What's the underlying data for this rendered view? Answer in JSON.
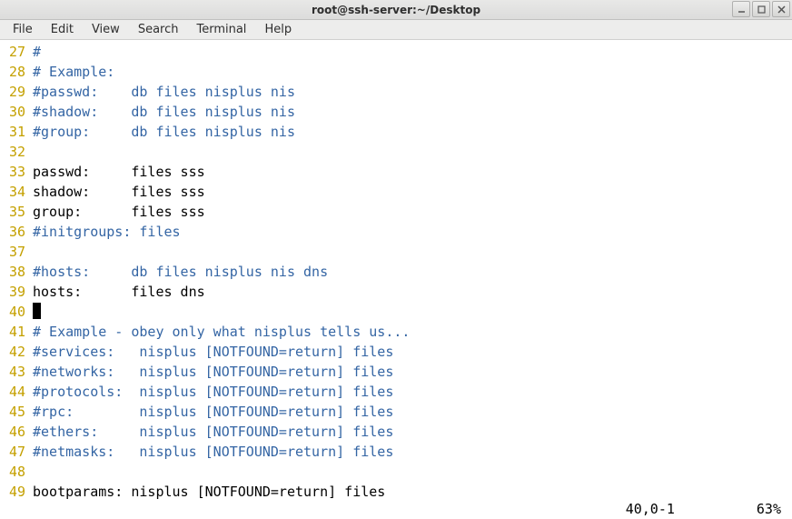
{
  "window": {
    "title": "root@ssh-server:~/Desktop"
  },
  "menu": {
    "file": "File",
    "edit": "Edit",
    "view": "View",
    "search": "Search",
    "terminal": "Terminal",
    "help": "Help"
  },
  "lines": [
    {
      "num": "27",
      "type": "comment",
      "text": "#"
    },
    {
      "num": "28",
      "type": "comment",
      "text": "# Example:"
    },
    {
      "num": "29",
      "type": "comment",
      "text": "#passwd:    db files nisplus nis"
    },
    {
      "num": "30",
      "type": "comment",
      "text": "#shadow:    db files nisplus nis"
    },
    {
      "num": "31",
      "type": "comment",
      "text": "#group:     db files nisplus nis"
    },
    {
      "num": "32",
      "type": "plain",
      "text": ""
    },
    {
      "num": "33",
      "type": "plain",
      "text": "passwd:     files sss"
    },
    {
      "num": "34",
      "type": "plain",
      "text": "shadow:     files sss"
    },
    {
      "num": "35",
      "type": "plain",
      "text": "group:      files sss"
    },
    {
      "num": "36",
      "type": "comment",
      "text": "#initgroups: files"
    },
    {
      "num": "37",
      "type": "plain",
      "text": ""
    },
    {
      "num": "38",
      "type": "comment",
      "text": "#hosts:     db files nisplus nis dns"
    },
    {
      "num": "39",
      "type": "plain",
      "text": "hosts:      files dns"
    },
    {
      "num": "40",
      "type": "cursor",
      "text": ""
    },
    {
      "num": "41",
      "type": "comment",
      "text": "# Example - obey only what nisplus tells us..."
    },
    {
      "num": "42",
      "type": "comment",
      "text": "#services:   nisplus [NOTFOUND=return] files"
    },
    {
      "num": "43",
      "type": "comment",
      "text": "#networks:   nisplus [NOTFOUND=return] files"
    },
    {
      "num": "44",
      "type": "comment",
      "text": "#protocols:  nisplus [NOTFOUND=return] files"
    },
    {
      "num": "45",
      "type": "comment",
      "text": "#rpc:        nisplus [NOTFOUND=return] files"
    },
    {
      "num": "46",
      "type": "comment",
      "text": "#ethers:     nisplus [NOTFOUND=return] files"
    },
    {
      "num": "47",
      "type": "comment",
      "text": "#netmasks:   nisplus [NOTFOUND=return] files"
    },
    {
      "num": "48",
      "type": "plain",
      "text": ""
    },
    {
      "num": "49",
      "type": "plain",
      "text": "bootparams: nisplus [NOTFOUND=return] files"
    }
  ],
  "status": {
    "position": "40,0-1",
    "percent": "63%"
  }
}
